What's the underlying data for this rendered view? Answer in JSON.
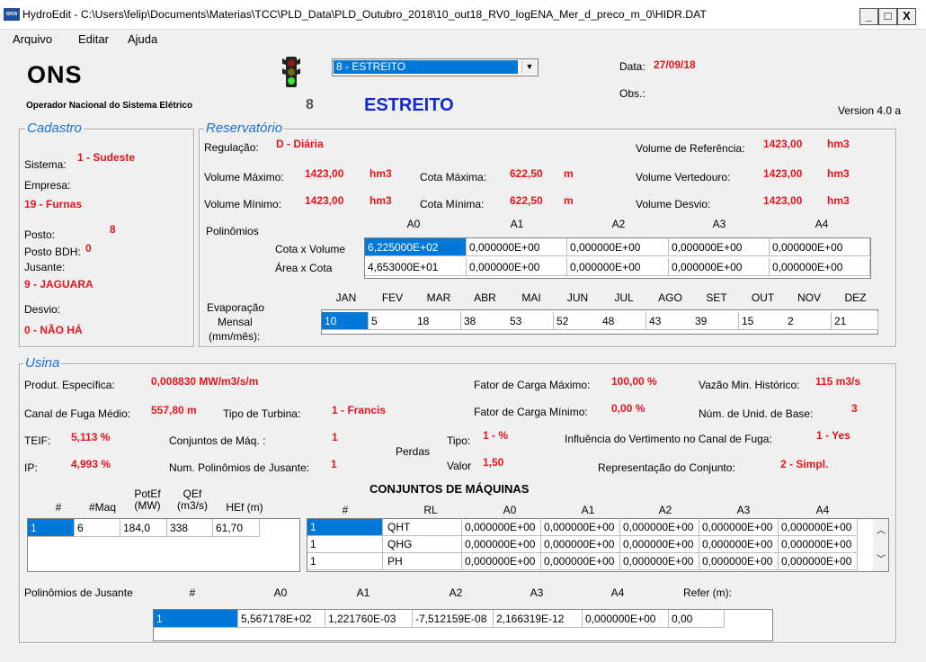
{
  "window": {
    "title": "HydroEdit - C:\\Users\\felip\\Documents\\Materias\\TCC\\PLD_Data\\PLD_Outubro_2018\\10_out18_RV0_logENA_Mer_d_preco_m_0\\HIDR.DAT",
    "minimize": "_",
    "maximize": "□",
    "close": "X"
  },
  "menu": {
    "arquivo": "Arquivo",
    "editar": "Editar",
    "ajuda": "Ajuda"
  },
  "header": {
    "logo_text": "ONS",
    "org_name": "Operador Nacional do Sistema Elétrico",
    "plant_select": "8 - ESTREITO",
    "plant_number": "8",
    "plant_name": "ESTREITO",
    "data_label": "Data:",
    "data_value": "27/09/18",
    "obs_label": "Obs.:",
    "version": "Version 4.0 a"
  },
  "cadastro": {
    "title": "Cadastro",
    "sistema_label": "Sistema:",
    "sistema_value": "1 - Sudeste",
    "empresa_label": "Empresa:",
    "empresa_value": "19 - Furnas",
    "posto_label": "Posto:",
    "posto_value": "8",
    "posto_bdh_label": "Posto BDH:",
    "posto_bdh_value": "0",
    "jusante_label": "Jusante:",
    "jusante_value": "9 - JAGUARA",
    "desvio_label": "Desvio:",
    "desvio_value": "0 - NÃO HÁ"
  },
  "reservatorio": {
    "title": "Reservatório",
    "regulacao_label": "Regulação:",
    "regulacao_value": "D - Diária",
    "vol_ref_label": "Volume de Referência:",
    "vol_ref_value": "1423,00",
    "vol_ref_unit": "hm3",
    "vol_max_label": "Volume Máximo:",
    "vol_max_value": "1423,00",
    "vol_max_unit": "hm3",
    "cota_max_label": "Cota Máxima:",
    "cota_max_value": "622,50",
    "cota_max_unit": "m",
    "vol_vert_label": "Volume Vertedouro:",
    "vol_vert_value": "1423,00",
    "vol_vert_unit": "hm3",
    "vol_min_label": "Volume Mínimo:",
    "vol_min_value": "1423,00",
    "vol_min_unit": "hm3",
    "cota_min_label": "Cota Mínima:",
    "cota_min_value": "622,50",
    "cota_min_unit": "m",
    "vol_desvio_label": "Volume Desvio:",
    "vol_desvio_value": "1423,00",
    "vol_desvio_unit": "hm3",
    "polinomios_label": "Polinômios",
    "poly_headers": [
      "A0",
      "A1",
      "A2",
      "A3",
      "A4"
    ],
    "cota_volume_label": "Cota x Volume",
    "cota_volume": [
      "6,225000E+02",
      "0,000000E+00",
      "0,000000E+00",
      "0,000000E+00",
      "0,000000E+00"
    ],
    "area_cota_label": "Área x Cota",
    "area_cota": [
      "4,653000E+01",
      "0,000000E+00",
      "0,000000E+00",
      "0,000000E+00",
      "0,000000E+00"
    ],
    "evap_label_1": "Evaporação",
    "evap_label_2": "Mensal",
    "evap_label_3": "(mm/mês):",
    "months": [
      "JAN",
      "FEV",
      "MAR",
      "ABR",
      "MAI",
      "JUN",
      "JUL",
      "AGO",
      "SET",
      "OUT",
      "NOV",
      "DEZ"
    ],
    "evap_values": [
      "10",
      "5",
      "18",
      "38",
      "53",
      "52",
      "48",
      "43",
      "39",
      "15",
      "2",
      "21"
    ]
  },
  "usina": {
    "title": "Usina",
    "produt_label": "Produt. Específica:",
    "produt_value": "0,008830 MW/m3/s/m",
    "fc_max_label": "Fator de Carga Máximo:",
    "fc_max_value": "100,00 %",
    "vazao_min_label": "Vazão Min. Histórico:",
    "vazao_min_value": "115 m3/s",
    "canal_label": "Canal de Fuga Médio:",
    "canal_value": "557,80 m",
    "turbina_label": "Tipo de Turbina:",
    "turbina_value": "1 - Francis",
    "fc_min_label": "Fator de Carga Mínimo:",
    "fc_min_value": "0,00 %",
    "num_unid_label": "Núm. de Unid. de Base:",
    "num_unid_value": "3",
    "teif_label": "TEIF:",
    "teif_value": "5,113 %",
    "conj_label": "Conjuntos de Máq. :",
    "conj_value": "1",
    "perdas_label": "Perdas",
    "tipo_label": "Tipo:",
    "tipo_value": "1 - %",
    "influencia_label": "Influência do Vertimento no Canal de Fuga:",
    "influencia_value": "1 - Yes",
    "ip_label": "IP:",
    "ip_value": "4,993 %",
    "num_poly_label": "Num. Polinômios de Jusante:",
    "num_poly_value": "1",
    "valor_label": "Valor",
    "valor_value": "1,50",
    "repr_label": "Representação do Conjunto:",
    "repr_value": "2 - Simpl.",
    "conjuntos_title": "CONJUNTOS DE MÁQUINAS",
    "maq_headers": [
      "#",
      "#Maq",
      "PotEf (MW)",
      "QEf (m3/s)",
      "HEf (m)"
    ],
    "maq_row": [
      "1",
      "6",
      "184,0",
      "338",
      "61,70"
    ],
    "poly_headers": [
      "#",
      "RL",
      "A0",
      "A1",
      "A2",
      "A3",
      "A4"
    ],
    "poly_rows": [
      [
        "1",
        "QHT",
        "0,000000E+00",
        "0,000000E+00",
        "0,000000E+00",
        "0,000000E+00",
        "0,000000E+00"
      ],
      [
        "1",
        "QHG",
        "0,000000E+00",
        "0,000000E+00",
        "0,000000E+00",
        "0,000000E+00",
        "0,000000E+00"
      ],
      [
        "1",
        "PH",
        "0,000000E+00",
        "0,000000E+00",
        "0,000000E+00",
        "0,000000E+00",
        "0,000000E+00"
      ]
    ],
    "jusante_label": "Polinômios de Jusante",
    "jusante_headers": [
      "#",
      "A0",
      "A1",
      "A2",
      "A3",
      "A4",
      "Refer (m):"
    ],
    "jusante_row": [
      "1",
      "5,567178E+02",
      "1,221760E-03",
      "-7,512159E-08",
      "2,166319E-12",
      "0,000000E+00",
      "0,00"
    ]
  }
}
